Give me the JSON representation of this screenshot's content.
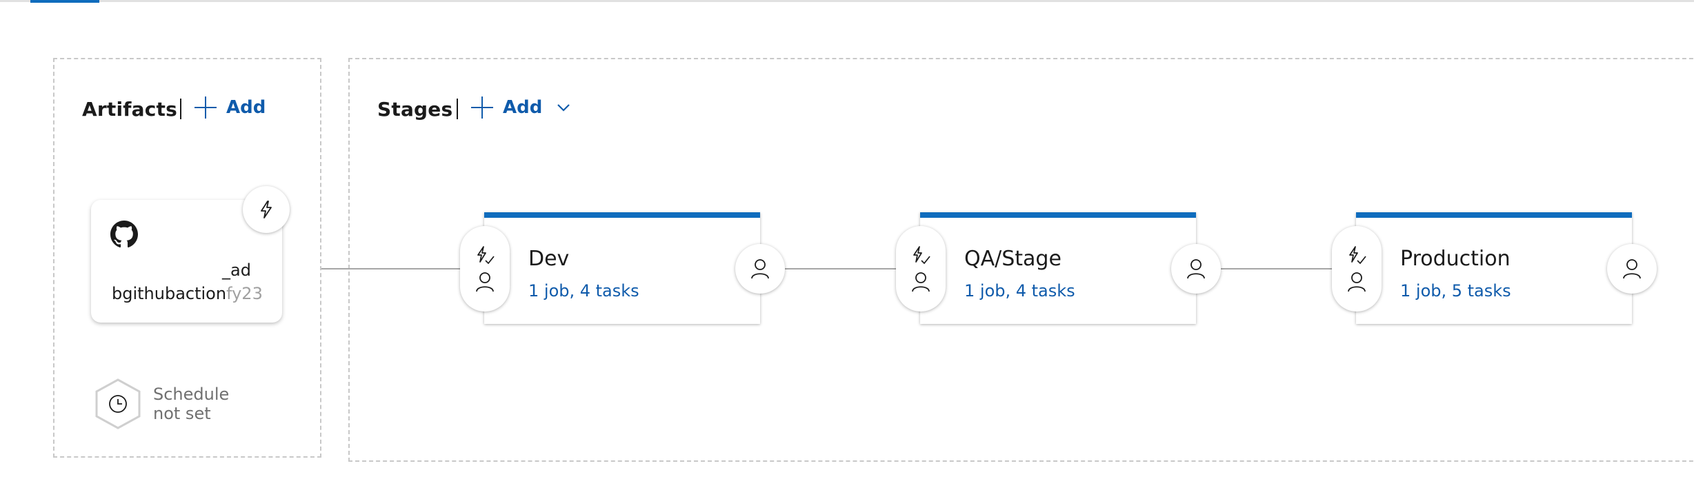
{
  "artifacts": {
    "title": "Artifacts",
    "add_label": "Add",
    "item": {
      "name_line1": "_ad",
      "name_line2_visible": "bgithubaction",
      "name_line2_faded": "fy23",
      "icon": "github-icon",
      "trigger_icon": "lightning-icon"
    },
    "schedule": {
      "line1": "Schedule",
      "line2": "not set",
      "icon": "clock-icon"
    }
  },
  "stages": {
    "title": "Stages",
    "add_label": "Add",
    "items": [
      {
        "name": "Dev",
        "tasks": "1 job, 4 tasks"
      },
      {
        "name": "QA/Stage",
        "tasks": "1 job, 4 tasks"
      },
      {
        "name": "Production",
        "tasks": "1 job, 5 tasks"
      }
    ]
  },
  "colors": {
    "accent": "#0f6cbd",
    "link": "#0f5bab",
    "border": "#c8c8c8"
  }
}
